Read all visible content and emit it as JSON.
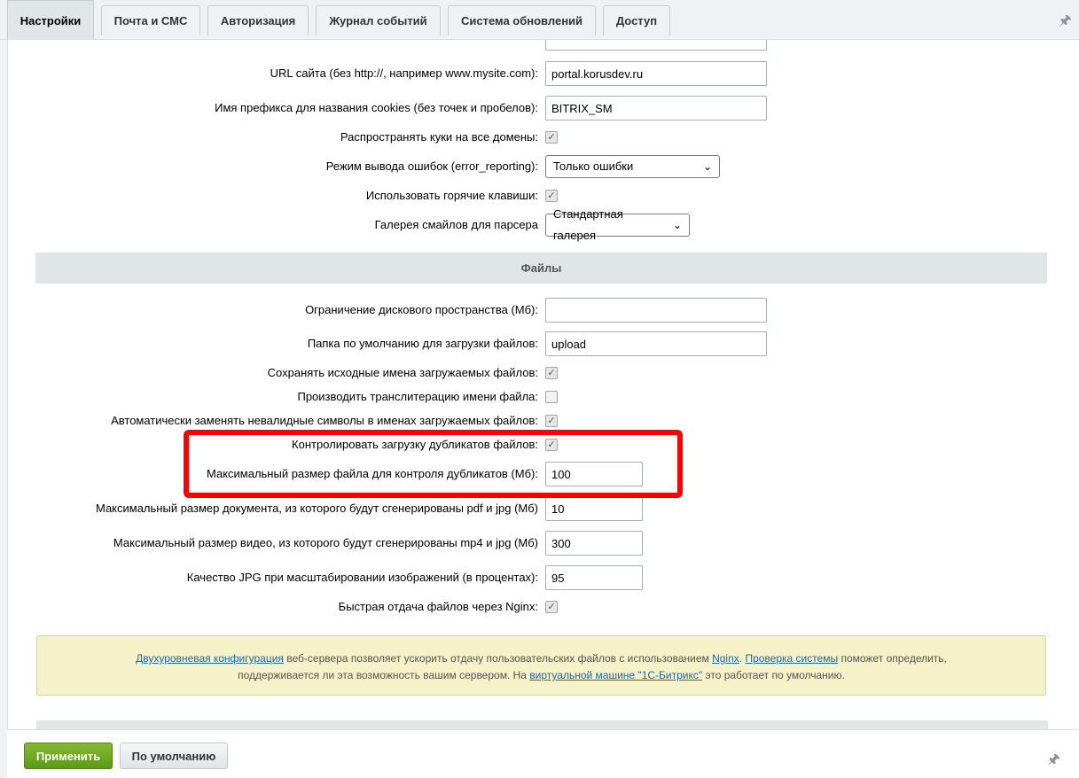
{
  "tabs": [
    {
      "label": "Настройки"
    },
    {
      "label": "Почта и СМС"
    },
    {
      "label": "Авторизация"
    },
    {
      "label": "Журнал событий"
    },
    {
      "label": "Система обновлений"
    },
    {
      "label": "Доступ"
    }
  ],
  "settings_top": {
    "url_label": "URL сайта (без http://, например www.mysite.com):",
    "url_value": "portal.korusdev.ru",
    "cookie_label": "Имя префикса для названия cookies (без точек и пробелов):",
    "cookie_value": "BITRIX_SM",
    "share_cookie_label": "Распространять куки на все домены:",
    "share_cookie_checked": true,
    "error_label": "Режим вывода ошибок (error_reporting):",
    "error_value": "Только ошибки",
    "hotkeys_label": "Использовать горячие клавиши:",
    "hotkeys_checked": true,
    "smiles_label": "Галерея смайлов для парсера",
    "smiles_value": "Стандартная галерея"
  },
  "files_section": {
    "title": "Файлы",
    "disk_limit_label": "Ограничение дискового пространства (Мб):",
    "disk_limit_value": "",
    "upload_dir_label": "Папка по умолчанию для загрузки файлов:",
    "upload_dir_value": "upload",
    "keep_names_label": "Сохранять исходные имена загружаемых файлов:",
    "keep_names_checked": true,
    "translit_label": "Производить транслитерацию имени файла:",
    "translit_checked": false,
    "auto_replace_label": "Автоматически заменять невалидные символы в именах загружаемых файлов:",
    "auto_replace_checked": true,
    "dup_control_label": "Контролировать загрузку дубликатов файлов:",
    "dup_control_checked": true,
    "dup_max_label": "Максимальный размер файла для контроля дубликатов (Мб):",
    "dup_max_value": "100",
    "doc_max_label": "Максимальный размер документа, из которого будут сгенерированы pdf и jpg (Мб)",
    "doc_max_value": "10",
    "video_max_label": "Максимальный размер видео, из которого будут сгенерированы mp4 и jpg (Мб)",
    "video_max_value": "300",
    "jpg_quality_label": "Качество JPG при масштабировании изображений (в процентах):",
    "jpg_quality_value": "95",
    "nginx_label": "Быстрая отдача файлов через Nginx:",
    "nginx_checked": true
  },
  "note": {
    "link1": "Двухуровневая конфигурация",
    "text1": " веб-сервера позволяет ускорить отдачу пользовательских файлов с использованием ",
    "link2": "Nginx",
    "text2": ". ",
    "link3": "Проверка системы",
    "text3": " поможет определить,",
    "text4": "поддерживается ли эта возможность вашим сервером. На ",
    "link4": "виртуальной машине \"1С-Битрикс\"",
    "text5": " это работает по умолчанию."
  },
  "footer": {
    "apply_label": "Применить",
    "default_label": "По умолчанию"
  },
  "icons": {
    "pin": "pin-icon",
    "check": "checkmark-icon",
    "chevron": "chevron-down-icon"
  },
  "colors": {
    "apply_green": "#6aa61f",
    "highlight_red": "#ff0000",
    "link_blue": "#2067b0",
    "note_bg": "#f5f1c8"
  }
}
